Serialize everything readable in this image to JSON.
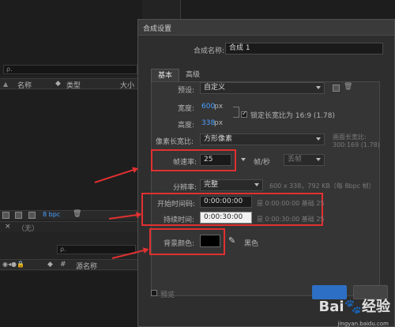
{
  "project_panel": {
    "search_placeholder": "ρ.",
    "col_name": "名称",
    "col_type": "类型",
    "col_size": "大小",
    "bpc": "8 bpc"
  },
  "timeline": {
    "label_none": "（无）",
    "search_placeholder": "ρ.",
    "col_source": "源名称"
  },
  "dialog": {
    "title": "合成设置",
    "comp_name_label": "合成名称:",
    "comp_name_value": "合成 1",
    "tabs": [
      "基本",
      "高级"
    ],
    "preset_label": "预设:",
    "preset_value": "自定义",
    "width_label": "宽度:",
    "width_value": "600",
    "height_label": "高度:",
    "height_value": "338",
    "px": "px",
    "lock_ratio_label": "锁定长宽比为 16:9 (1.78)",
    "pixel_aspect_label": "像素长宽比:",
    "pixel_aspect_value": "方形像素",
    "frame_aspect_label": "画面长宽比:",
    "frame_aspect_value": "300:169 (1.78)",
    "fps_label": "帧速率:",
    "fps_value": "25",
    "fps_unit": "帧/秒",
    "drop_frame": "丢帧",
    "resolution_label": "分辨率:",
    "resolution_value": "完整",
    "resolution_info": "600 x 338，792 KB（每 8bpc 帧）",
    "start_tc_label": "开始时间码:",
    "start_tc_value": "0:00:00:00",
    "start_tc_note": "是 0:00:00:00   基础 25",
    "duration_label": "持续时间:",
    "duration_value": "0:00:30:00",
    "duration_note": "是 0:00:30:00   基础 25",
    "bg_color_label": "背景颜色:",
    "bg_color_name": "黑色",
    "preview_label": "预览"
  },
  "watermark": {
    "brand": "Bai🐾经验",
    "url": "jingyan.baidu.com"
  },
  "colors": {
    "accent_red": "#e03030",
    "link_blue": "#4aa0ff",
    "bg_swatch": "#000000"
  }
}
